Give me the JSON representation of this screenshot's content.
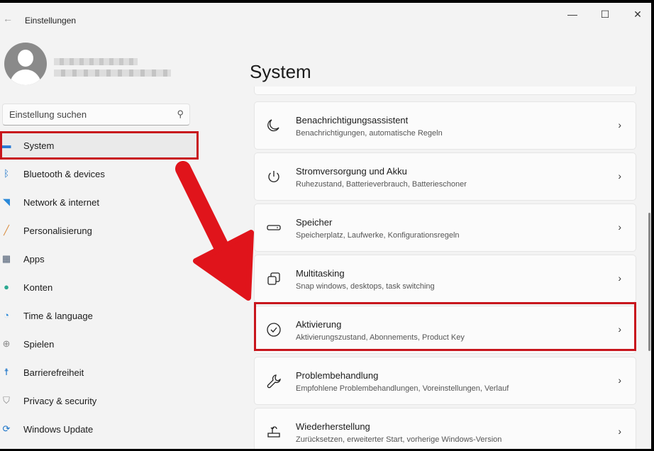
{
  "window": {
    "title": "Einstellungen",
    "back_icon": "arrow-left",
    "minimize": "—",
    "maximize": "☐",
    "close": "✕"
  },
  "search": {
    "placeholder": "Einstellung suchen",
    "icon": "search-icon"
  },
  "nav": [
    {
      "label": "System",
      "icon": "monitor",
      "color": "#2a7bd5"
    },
    {
      "label": "Bluetooth & devices",
      "icon": "bluetooth",
      "color": "#1a73c8"
    },
    {
      "label": "Network & internet",
      "icon": "wifi",
      "color": "#2a88d8"
    },
    {
      "label": "Personalisierung",
      "icon": "brush",
      "color": "#d88a3a"
    },
    {
      "label": "Apps",
      "icon": "apps",
      "color": "#4a5a70"
    },
    {
      "label": "Konten",
      "icon": "person",
      "color": "#2aa890"
    },
    {
      "label": "Time & language",
      "icon": "clock-globe",
      "color": "#2a88d8"
    },
    {
      "label": "Spielen",
      "icon": "gamepad",
      "color": "#888"
    },
    {
      "label": "Barrierefreiheit",
      "icon": "accessibility",
      "color": "#1a73c8"
    },
    {
      "label": "Privacy & security",
      "icon": "shield",
      "color": "#888"
    },
    {
      "label": "Windows Update",
      "icon": "sync",
      "color": "#1a73c8"
    }
  ],
  "main": {
    "heading": "System",
    "cards": [
      {
        "title": "Benachrichtigungsassistent",
        "subtitle": "Benachrichtigungen, automatische Regeln",
        "icon": "moon"
      },
      {
        "title": "Stromversorgung und Akku",
        "subtitle": "Ruhezustand, Batterieverbrauch, Batterieschoner",
        "icon": "power"
      },
      {
        "title": "Speicher",
        "subtitle": "Speicherplatz, Laufwerke, Konfigurationsregeln",
        "icon": "storage"
      },
      {
        "title": "Multitasking",
        "subtitle": "Snap windows, desktops, task switching",
        "icon": "multitask"
      },
      {
        "title": "Aktivierung",
        "subtitle": "Aktivierungszustand, Abonnements, Product Key",
        "icon": "check-circle"
      },
      {
        "title": "Problembehandlung",
        "subtitle": "Empfohlene Problembehandlungen, Voreinstellungen, Verlauf",
        "icon": "wrench"
      },
      {
        "title": "Wiederherstellung",
        "subtitle": "Zurücksetzen, erweiterter Start, vorherige Windows-Version",
        "icon": "recovery"
      }
    ]
  },
  "annotation_color": "#c8161d"
}
